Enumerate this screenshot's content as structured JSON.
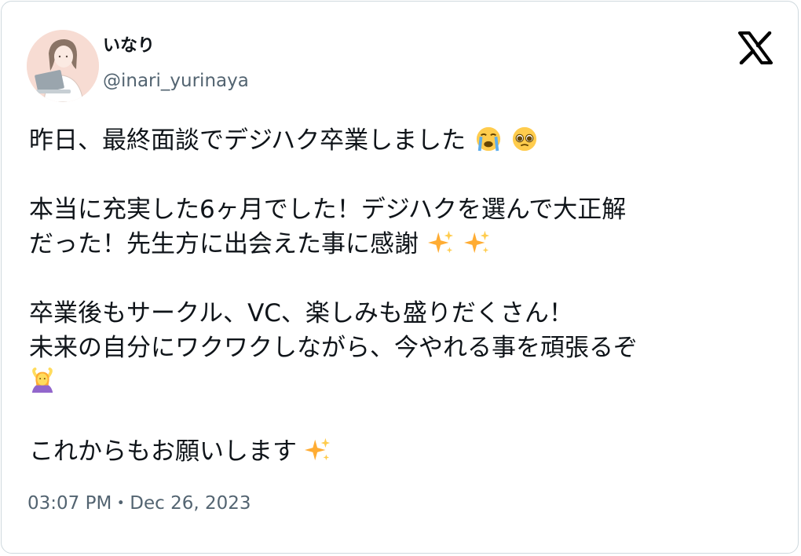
{
  "author": {
    "display_name": "いなり",
    "handle": "@inari_yurinaya",
    "avatar_icon": "avatar-illustration-person-with-laptop"
  },
  "platform_icon": "x-logo-icon",
  "tweet": {
    "lines": [
      "昨日、最終面談でデジハク卒業しました",
      "本当に充実した6ヶ月でした！デジハクを選んで大正解",
      "だった！先生方に出会えた事に感謝",
      "卒業後もサークル、VC、楽しみも盛りだくさん！",
      "未来の自分にワクワクしながら、今やれる事を頑張るぞ",
      "これからもお願いします"
    ],
    "emojis": {
      "line1": [
        "loudly-crying-face-emoji",
        "pleading-face-emoji"
      ],
      "line3": [
        "sparkles-emoji",
        "sparkles-emoji"
      ],
      "line5_wrap": [
        "person-gesturing-ok-emoji"
      ],
      "line6": [
        "sparkles-emoji"
      ]
    }
  },
  "timestamp": "03:07 PM・Dec 26, 2023",
  "colors": {
    "text": "#0f1419",
    "secondary_text": "#536471",
    "border": "#cfd9de",
    "avatar_bg": "#f7dcd3"
  }
}
